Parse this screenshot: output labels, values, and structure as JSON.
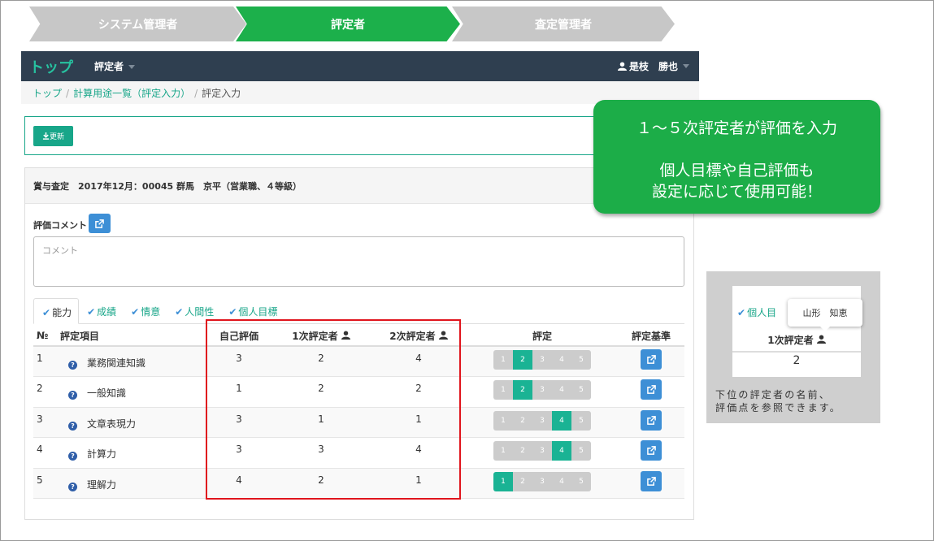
{
  "steps": [
    "システム管理者",
    "評定者",
    "査定管理者"
  ],
  "navbar": {
    "brand": "トップ",
    "role": "評定者",
    "user": "是枝　勝也"
  },
  "breadcrumb": [
    "トップ",
    "/",
    "計算用途一覧（評定入力）",
    "/",
    "評定入力"
  ],
  "update_button": "更新",
  "panel_title": "賞与査定　2017年12月：00045 群馬　京平（営業職、４等級）",
  "comment": {
    "label": "評価コメント",
    "placeholder": "コメント"
  },
  "tabs": [
    "能力",
    "成績",
    "情意",
    "人間性",
    "個人目標"
  ],
  "columns": {
    "no": "№",
    "item": "評定項目",
    "self": "自己評価",
    "rater1": "1次評定者",
    "rater2": "2次評定者",
    "rating": "評定",
    "criteria": "評定基準"
  },
  "rows": [
    {
      "no": "1",
      "item": "業務関連知識",
      "self": "3",
      "r1": "2",
      "r2": "4",
      "selected": 2
    },
    {
      "no": "2",
      "item": "一般知識",
      "self": "1",
      "r1": "2",
      "r2": "2",
      "selected": 2
    },
    {
      "no": "3",
      "item": "文章表現力",
      "self": "3",
      "r1": "1",
      "r2": "1",
      "selected": 4
    },
    {
      "no": "4",
      "item": "計算力",
      "self": "3",
      "r1": "3",
      "r2": "4",
      "selected": 4
    },
    {
      "no": "5",
      "item": "理解力",
      "self": "4",
      "r1": "2",
      "r2": "1",
      "selected": 1
    }
  ],
  "scale": [
    "1",
    "2",
    "3",
    "4",
    "5"
  ],
  "callout": {
    "line1": "１～５次評定者が評価を入力",
    "line2": "個人目標や自己評価も",
    "line3": "設定に応じて使用可能！"
  },
  "side_preview": {
    "tab": "個人目",
    "tooltip": "山形　知恵",
    "header": "1次評定者",
    "value": "2",
    "note_line1": "下位の評定者の名前、",
    "note_line2": "評価点を参照できます。"
  },
  "colors": {
    "accent": "#18a689",
    "step_active": "#1cb04b",
    "navbar": "#2f3f50",
    "highlight": "#e0151d",
    "button_blue": "#3d8fd6"
  }
}
